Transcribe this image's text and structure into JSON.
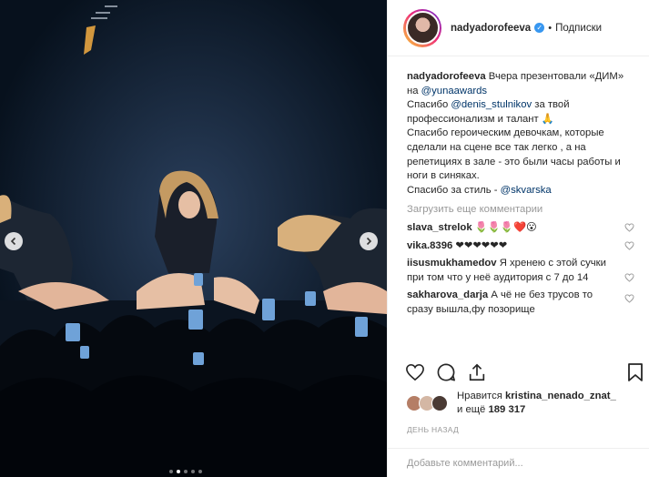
{
  "post": {
    "username": "nadyadorofeeva",
    "follow_label": "Подписки",
    "separator": "•",
    "verified_glyph": "✓",
    "caption_username": "nadyadorofeeva",
    "caption_parts": [
      " Вчера презентовали «ДИМ» на ",
      "@yunaawards",
      "\nСпасибо ",
      "@denis_stulnikov",
      " за твой профессионализм и талант 🙏\nСпасибо героическим девочкам, которые сделали на сцене все так легко , а на репетициях в зале - это были часы работы и ноги в синяках.\nСпасибо за стиль - ",
      "@skvarska"
    ],
    "load_more": "Загрузить еще комментарии",
    "comments": [
      {
        "user": "slava_strelok",
        "text": " 🌷🌷🌷❤️😮"
      },
      {
        "user": "vika.8396",
        "text": " ❤❤❤❤❤❤"
      },
      {
        "user": "iisusmukhamedov",
        "text": " Я хренею с этой сучки при том что у неё аудитория с 7 до 14"
      },
      {
        "user": "sakharova_darja",
        "text": " А чё не без трусов то сразу вышла,фу позорище"
      }
    ],
    "likes_prefix": "Нравится ",
    "likes_user": "kristina_nenado_znat_",
    "likes_mid": " и ещё ",
    "likes_count": "189 317",
    "date": "ДЕНЬ НАЗАД",
    "add_comment_placeholder": "Добавьте комментарий...",
    "carousel": {
      "total": 5,
      "active": 2
    }
  },
  "icons": [
    "heart-icon",
    "comment-icon",
    "share-icon",
    "bookmark-icon",
    "chevron-left-icon",
    "chevron-right-icon",
    "verified-icon"
  ],
  "colors": {
    "link": "#003569",
    "verified": "#3897f0",
    "muted": "#999999",
    "photo_bg": "#0a1626"
  }
}
